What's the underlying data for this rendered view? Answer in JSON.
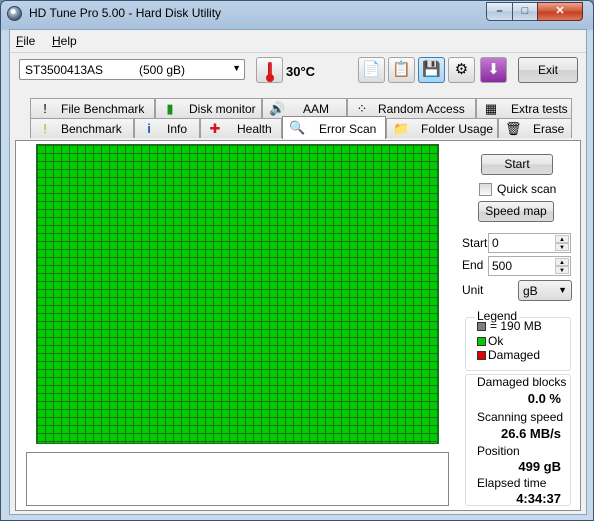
{
  "window": {
    "title": "HD Tune Pro 5.00 - Hard Disk Utility",
    "minimize": "–",
    "maximize": "□",
    "close": "✕"
  },
  "menu": [
    {
      "label": "File",
      "underline": "F",
      "rest": "ile"
    },
    {
      "label": "Help",
      "underline": "H",
      "rest": "elp"
    }
  ],
  "toolbar": {
    "drive_name": "ST3500413AS",
    "drive_size": "(500 gB)",
    "temperature": "30",
    "temperature_unit": "°C",
    "exit_label": "Exit",
    "tool_buttons": [
      {
        "name": "copy-text-icon",
        "glyph": "📄"
      },
      {
        "name": "copy-image-icon",
        "glyph": "📋"
      },
      {
        "name": "save-icon",
        "glyph": "💾"
      },
      {
        "name": "options-gears-icon",
        "glyph": "⚙"
      },
      {
        "name": "download-icon",
        "glyph": "⬇"
      }
    ]
  },
  "tabs_row1": [
    {
      "label": "File Benchmark",
      "icon": "file-benchmark-icon",
      "glyph": "!"
    },
    {
      "label": "Disk monitor",
      "icon": "disk-monitor-icon",
      "glyph": "▮"
    },
    {
      "label": "AAM",
      "icon": "speaker-icon",
      "glyph": "🔊"
    },
    {
      "label": "Random Access",
      "icon": "random-access-icon",
      "glyph": "⁘"
    },
    {
      "label": "Extra tests",
      "icon": "extra-tests-icon",
      "glyph": "▦"
    }
  ],
  "tabs_row2": [
    {
      "label": "Benchmark",
      "icon": "benchmark-icon",
      "glyph": "!"
    },
    {
      "label": "Info",
      "icon": "info-icon",
      "glyph": "i"
    },
    {
      "label": "Health",
      "icon": "health-cross-icon",
      "glyph": "✚"
    },
    {
      "label": "Error Scan",
      "icon": "magnifier-icon",
      "glyph": "🔍",
      "selected": true
    },
    {
      "label": "Folder Usage",
      "icon": "folder-icon",
      "glyph": "📁"
    },
    {
      "label": "Erase",
      "icon": "trash-icon",
      "glyph": "🗑"
    }
  ],
  "scan": {
    "start_button": "Start",
    "quick_scan_label": "Quick scan",
    "quick_scan_checked": false,
    "speed_map_button": "Speed map",
    "start_label": "Start",
    "start_value": "0",
    "end_label": "End",
    "end_value": "500",
    "unit_label": "Unit",
    "unit_value": "gB",
    "log_text": ""
  },
  "legend": {
    "title": "Legend",
    "block_size": "= 190 MB",
    "ok": "Ok",
    "damaged": "Damaged"
  },
  "stats": {
    "damaged_blocks_label": "Damaged blocks",
    "damaged_blocks_value": "0.0 %",
    "scanning_speed_label": "Scanning speed",
    "scanning_speed_value": "26.6 MB/s",
    "position_label": "Position",
    "position_value": "499 gB",
    "elapsed_label": "Elapsed time",
    "elapsed_value": "4:34:37"
  },
  "colors": {
    "ok_block": "#00cc00",
    "damaged_block": "#e00000",
    "block_size_swatch": "#7f7f7f",
    "selected_tab": "#ffffff"
  }
}
